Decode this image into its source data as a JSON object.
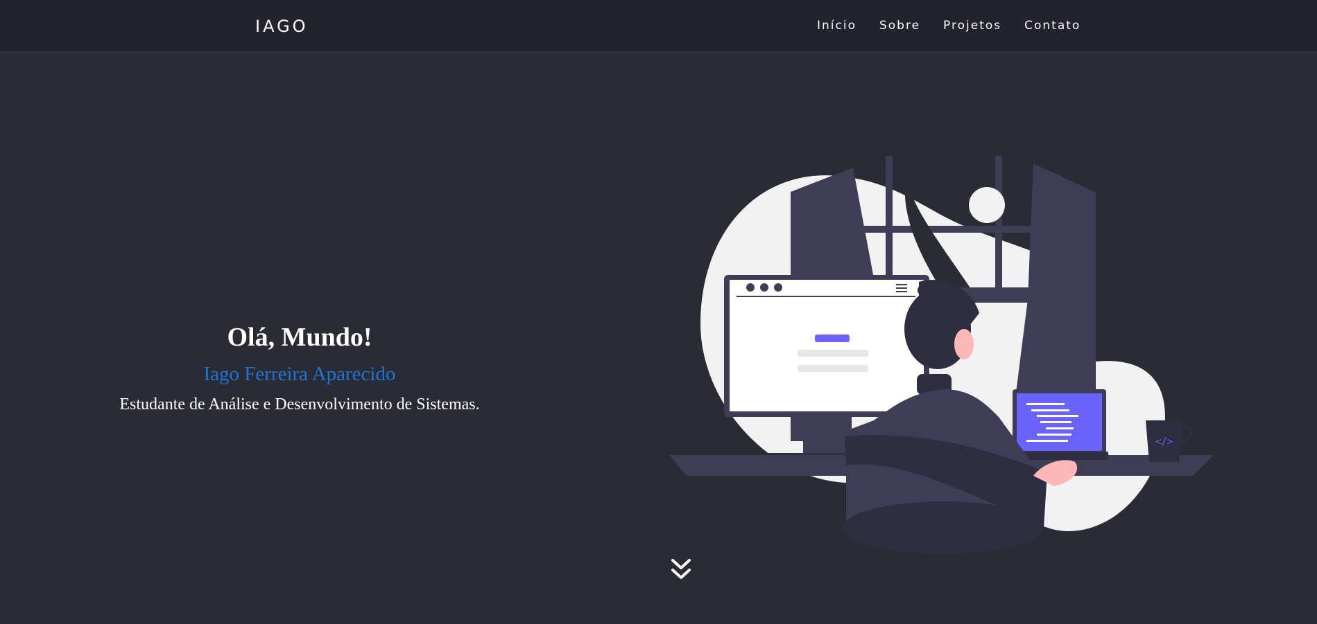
{
  "nav": {
    "brand": "IAGO",
    "links": [
      "Início",
      "Sobre",
      "Projetos",
      "Contato"
    ]
  },
  "hero": {
    "title": "Olá, Mundo!",
    "name": "Iago Ferreira Aparecido",
    "subtitle": "Estudante de Análise e Desenvolvimento de Sistemas.",
    "illustration_icon": "programmer-at-desk-illustration",
    "mug_text": "</>",
    "scroll_icon": "double-chevron-down-icon"
  },
  "colors": {
    "background": "#2b2b36",
    "navbar": "#23232d",
    "accent_blue": "#1e74d6",
    "accent_purple": "#6c63ff",
    "illustration_dark": "#3f3d56",
    "illustration_light": "#f2f2f2"
  }
}
